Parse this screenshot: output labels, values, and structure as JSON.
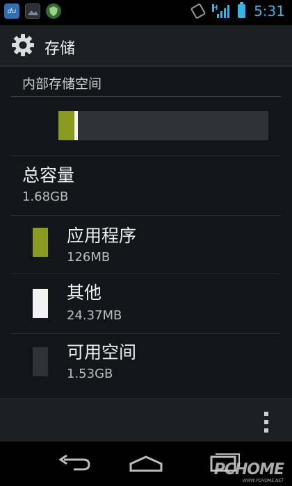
{
  "status_bar": {
    "icons": [
      "du-icon",
      "gallery-icon",
      "shield-icon",
      "screen-rotation-icon",
      "signal-icon",
      "battery-icon"
    ],
    "network_label": "H",
    "time": "5:31"
  },
  "action_bar": {
    "icon": "gear-icon",
    "title": "存储"
  },
  "section": {
    "title": "内部存储空间"
  },
  "usage_bar": {
    "app_fraction": 0.075,
    "other_fraction": 0.015,
    "colors": {
      "apps": "#8a9a1e",
      "other": "#f2f2f2",
      "free": "#2f3236"
    }
  },
  "total": {
    "label": "总容量",
    "value": "1.68GB"
  },
  "categories": [
    {
      "name": "应用程序",
      "size": "126MB",
      "color": "#8a9a1e"
    },
    {
      "name": "其他",
      "size": "24.37MB",
      "color": "#f2f2f2"
    },
    {
      "name": "可用空间",
      "size": "1.53GB",
      "color": "#2f3236"
    }
  ],
  "bottom": {
    "menu_icon": "overflow-menu-icon"
  },
  "nav": {
    "buttons": [
      "back-icon",
      "home-icon",
      "recent-apps-icon"
    ]
  },
  "watermark": {
    "text": "PCHOME",
    "sub": "WWW.PCHOME.NET"
  }
}
